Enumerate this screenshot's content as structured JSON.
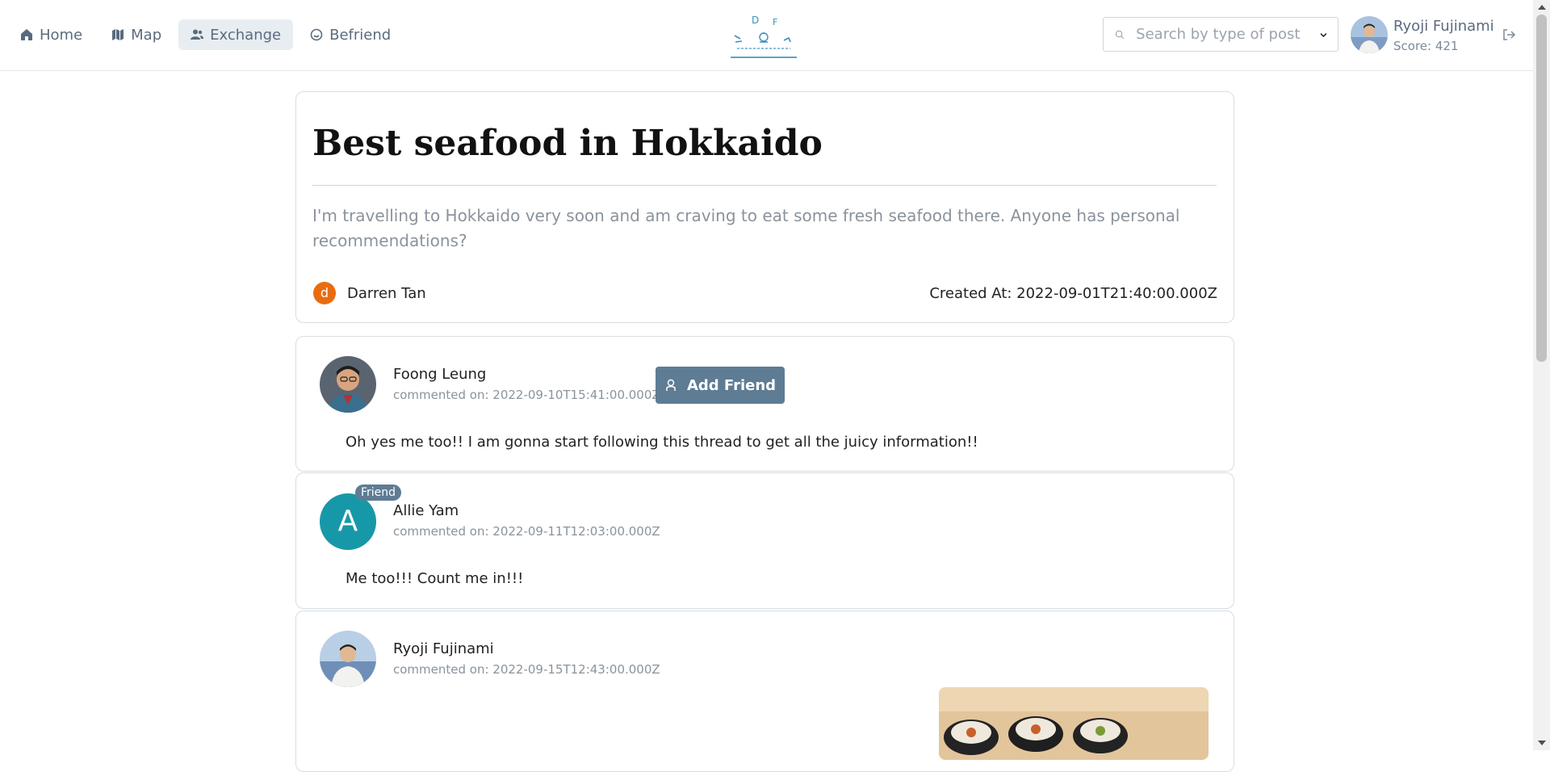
{
  "nav": {
    "items": [
      {
        "label": "Home",
        "icon": "home-icon"
      },
      {
        "label": "Map",
        "icon": "map-icon"
      },
      {
        "label": "Exchange",
        "icon": "users-icon",
        "active": true
      },
      {
        "label": "Befriend",
        "icon": "smile-icon"
      }
    ]
  },
  "search": {
    "placeholder": "Search by type of post"
  },
  "user": {
    "name": "Ryoji Fujinami",
    "score": "Score: 421"
  },
  "post": {
    "title": "Best seafood in Hokkaido",
    "body": "I'm travelling to Hokkaido very soon and am craving to eat some fresh seafood there. Anyone has personal recommendations?",
    "author_initial": "d",
    "author": "Darren Tan",
    "created": "Created At: 2022-09-01T21:40:00.000Z"
  },
  "comments": [
    {
      "name": "Foong Leung",
      "date": "commented on: 2022-09-10T15:41:00.000Z",
      "text": "Oh yes me too!! I am gonna start following this thread to get all the juicy information!!",
      "action": "Add Friend"
    },
    {
      "name": "Allie Yam",
      "initial": "A",
      "badge": "Friend",
      "date": "commented on: 2022-09-11T12:03:00.000Z",
      "text": "Me too!!! Count me in!!!"
    },
    {
      "name": "Ryoji Fujinami",
      "date": "commented on: 2022-09-15T12:43:00.000Z",
      "text": ""
    }
  ],
  "colors": {
    "accent": "#5e7c94",
    "author_badge": "#ea6c10",
    "letter_avatar": "#1798a8"
  }
}
